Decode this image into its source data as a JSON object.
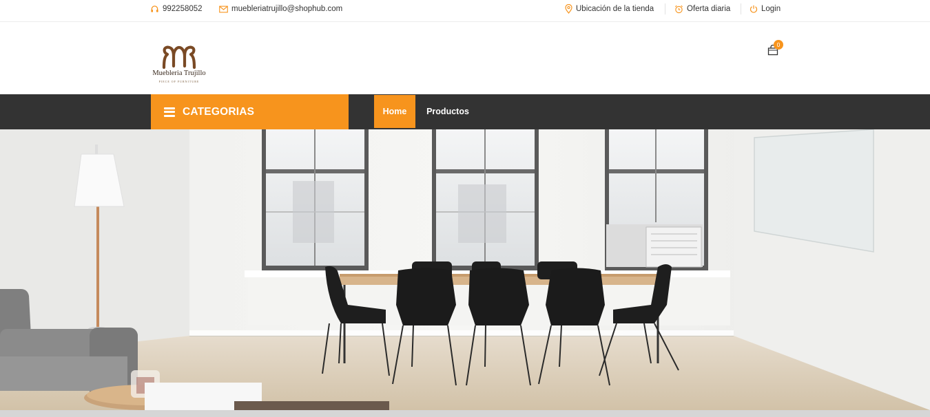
{
  "topbar": {
    "phone": "992258052",
    "email": "muebleriatrujillo@shophub.com",
    "store_location": "Ubicación de la tienda",
    "daily_offer": "Oferta diaria",
    "login": "Login"
  },
  "brand": {
    "name": "Muebleria Trujillo",
    "tagline": "PIECE OF FURNITURE"
  },
  "cart": {
    "count": "0"
  },
  "nav": {
    "categories_label": "CATEGORIAS",
    "links": [
      {
        "label": "Home",
        "active": true
      },
      {
        "label": "Productos",
        "active": false
      }
    ]
  },
  "icons": {
    "phone": "headset-icon",
    "email": "envelope-icon",
    "store": "map-pin-icon",
    "offer": "alarm-clock-icon",
    "login": "power-icon",
    "cart": "shopping-bag-icon",
    "menu": "hamburger-menu-icon"
  },
  "colors": {
    "accent": "#f7941d",
    "navbar": "#333333",
    "brand_brown": "#7a4a25"
  }
}
